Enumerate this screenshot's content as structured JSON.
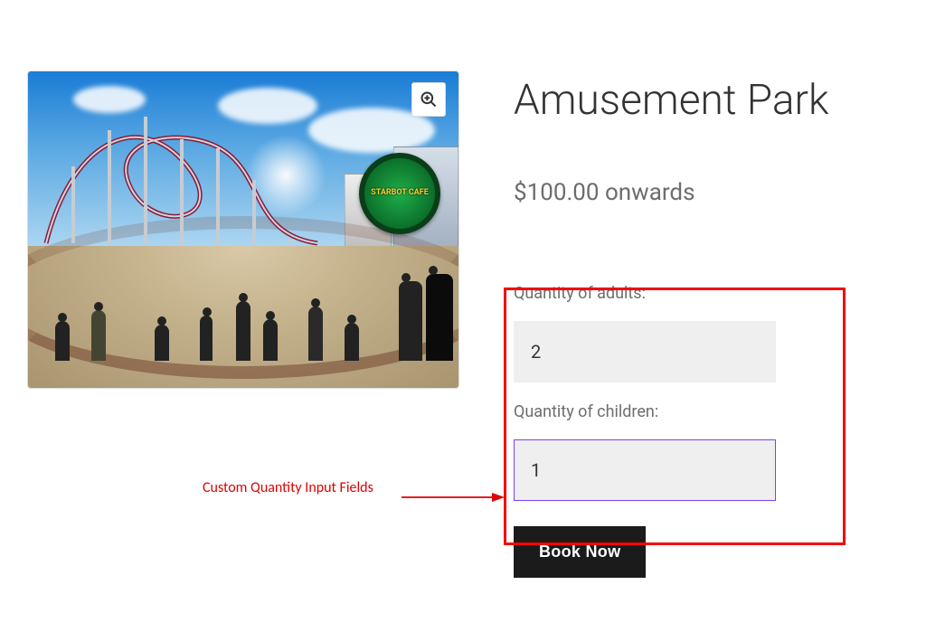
{
  "product": {
    "title": "Amusement Park",
    "price_display": "$100.00 onwards",
    "image_alt": "Amusement park roller coaster photo",
    "sign_text": "STARBOT CAFE"
  },
  "form": {
    "adults_label": "Quantity of adults:",
    "adults_value": "2",
    "children_label": "Quantity of children:",
    "children_value": "1",
    "book_label": "Book Now"
  },
  "zoom": {
    "icon_name": "magnifier-plus"
  },
  "annotation": {
    "label": "Custom Quantity Input Fields"
  }
}
